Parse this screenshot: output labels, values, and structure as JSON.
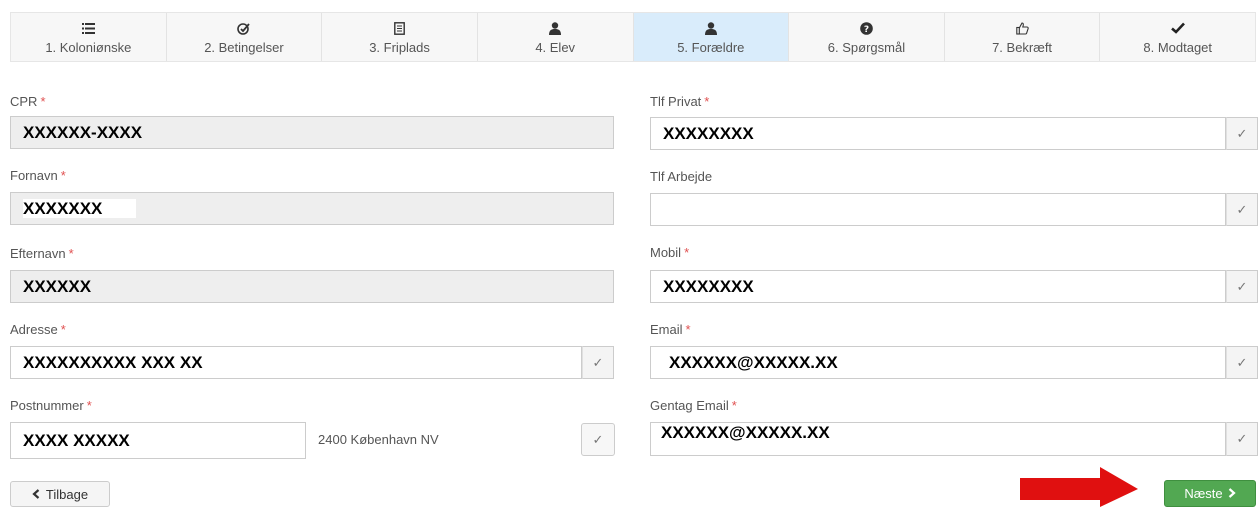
{
  "steps": [
    {
      "label": "1. Koloniønske",
      "icon": "list-icon"
    },
    {
      "label": "2. Betingelser",
      "icon": "check-circle-icon"
    },
    {
      "label": "3. Friplads",
      "icon": "document-icon"
    },
    {
      "label": "4. Elev",
      "icon": "user-icon"
    },
    {
      "label": "5. Forældre",
      "icon": "user-icon",
      "active": true
    },
    {
      "label": "6. Spørgsmål",
      "icon": "question-circle-icon"
    },
    {
      "label": "7. Bekræft",
      "icon": "thumbs-up-icon"
    },
    {
      "label": "8. Modtaget",
      "icon": "checkmark-icon"
    }
  ],
  "form": {
    "required_mark": "*",
    "cpr": {
      "label": "CPR",
      "value": "XXXXXX-XXXX"
    },
    "fornavn": {
      "label": "Fornavn",
      "value": "XXXXXXX"
    },
    "efternavn": {
      "label": "Efternavn",
      "value": "XXXXXX"
    },
    "adresse": {
      "label": "Adresse",
      "value": "XXXXXXXXXX XXX XX"
    },
    "postnummer": {
      "label": "Postnummer",
      "value": "XXXX XXXXX",
      "city": "2400 København NV"
    },
    "tlf_privat": {
      "label": "Tlf Privat",
      "value": "XXXXXXXX"
    },
    "tlf_arbejde": {
      "label": "Tlf Arbejde",
      "value": ""
    },
    "mobil": {
      "label": "Mobil",
      "value": "XXXXXXXX"
    },
    "email": {
      "label": "Email",
      "value": "XXXXXX@XXXXX.XX"
    },
    "gentag_email": {
      "label": "Gentag Email",
      "value": "XXXXXX@XXXXX.XX"
    }
  },
  "buttons": {
    "back": "Tilbage",
    "next": "Næste"
  },
  "colors": {
    "active_step": "#d9ecfb",
    "next_button": "#52a852",
    "arrow": "#e01010",
    "required": "#e05050"
  }
}
